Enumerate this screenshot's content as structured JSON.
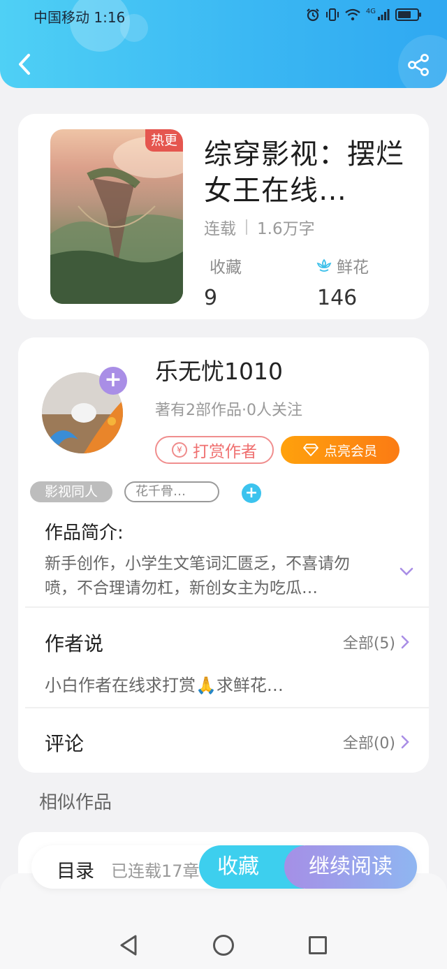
{
  "status_bar": {
    "carrier_time": "中国移动 1:16",
    "network": "4G"
  },
  "header": {
    "back_icon": "chevron-left-icon",
    "share_icon": "share-icon"
  },
  "book": {
    "badge": "热更",
    "title": "综穿影视：摆烂女王在线…",
    "status": "连载",
    "word_count": "1.6万字",
    "favorites_label": "收藏",
    "favorites_value": "9",
    "flowers_label": "鲜花",
    "flowers_value": "146"
  },
  "author": {
    "name": "乐无忧1010",
    "info": "著有2部作品·0人关注",
    "tip_label": "打赏作者",
    "vip_label": "点亮会员",
    "follow_symbol": "+"
  },
  "tags": {
    "items": [
      "影视同人",
      "花千骨…"
    ],
    "add_symbol": "+"
  },
  "intro": {
    "title": "作品简介:",
    "text": "新手创作，小学生文笔词汇匮乏，不喜请勿喷，不合理请勿杠，新创女主为吃瓜…"
  },
  "author_says": {
    "title": "作者说",
    "more": "全部(5)",
    "text": "小白作者在线求打赏🙏求鲜花…"
  },
  "comments": {
    "title": "评论",
    "more": "全部(0)"
  },
  "similar": {
    "title": "相似作品"
  },
  "action_bar": {
    "toc_label": "目录",
    "toc_count": "已连载17章",
    "favorite_label": "收藏",
    "read_label": "继续阅读"
  },
  "colors": {
    "header_start": "#4fd0f5",
    "header_end": "#2fa8f1",
    "tip_red": "#ef6f6f",
    "vip_orange": "#fb8a12",
    "accent_purple": "#a98ee6",
    "accent_cyan": "#3dcfee"
  }
}
